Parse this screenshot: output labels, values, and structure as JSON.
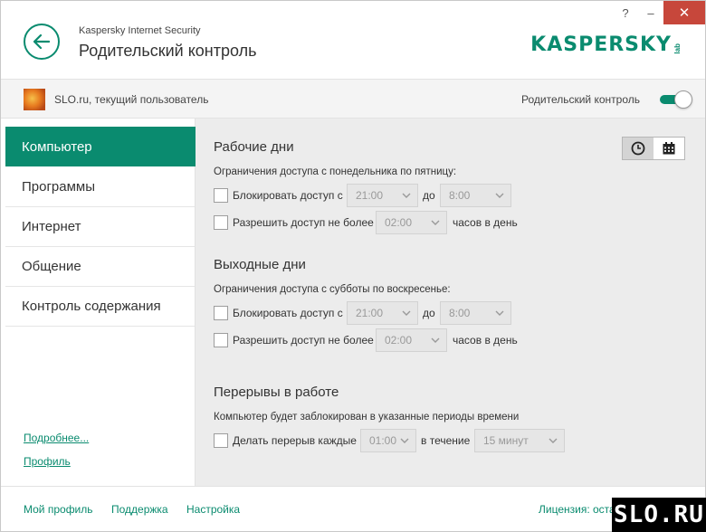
{
  "window": {
    "app_title": "Kaspersky Internet Security",
    "page_title": "Родительский контроль",
    "help": "?",
    "minimize": "–",
    "close": "✕",
    "logo_text": "KASPERSKY",
    "logo_lab": "lab"
  },
  "userbar": {
    "user_label": "SLO.ru, текущий пользователь",
    "parental_control_label": "Родительский контроль",
    "parental_control_on": true
  },
  "sidebar": {
    "items": [
      {
        "label": "Компьютер",
        "active": true
      },
      {
        "label": "Программы",
        "active": false
      },
      {
        "label": "Интернет",
        "active": false
      },
      {
        "label": "Общение",
        "active": false
      },
      {
        "label": "Контроль содержания",
        "active": false
      }
    ],
    "more_link": "Подробнее...",
    "profile_link": "Профиль"
  },
  "content": {
    "workdays": {
      "title": "Рабочие дни",
      "desc": "Ограничения доступа с понедельника по пятницу:",
      "block_label": "Блокировать доступ с",
      "block_from": "21:00",
      "to_label": "до",
      "block_to": "8:00",
      "allow_label": "Разрешить доступ не более",
      "allow_value": "02:00",
      "hours_label": "часов в день"
    },
    "weekend": {
      "title": "Выходные дни",
      "desc": "Ограничения доступа с субботы по воскресенье:",
      "block_label": "Блокировать доступ с",
      "block_from": "21:00",
      "to_label": "до",
      "block_to": "8:00",
      "allow_label": "Разрешить доступ не более",
      "allow_value": "02:00",
      "hours_label": "часов в день"
    },
    "breaks": {
      "title": "Перерывы в работе",
      "desc": "Компьютер будет заблокирован в указанные периоды времени",
      "break_label": "Делать перерыв каждые",
      "break_every": "01:00",
      "during_label": "в течение",
      "break_duration": "15 минут"
    }
  },
  "footer": {
    "my_profile": "Мой профиль",
    "support": "Поддержка",
    "settings": "Настройка",
    "license": "Лицензия: оста"
  },
  "watermark": "SLO.RU",
  "colors": {
    "accent": "#0a8b6f",
    "close_button": "#c7473b",
    "content_bg": "#ececec"
  }
}
